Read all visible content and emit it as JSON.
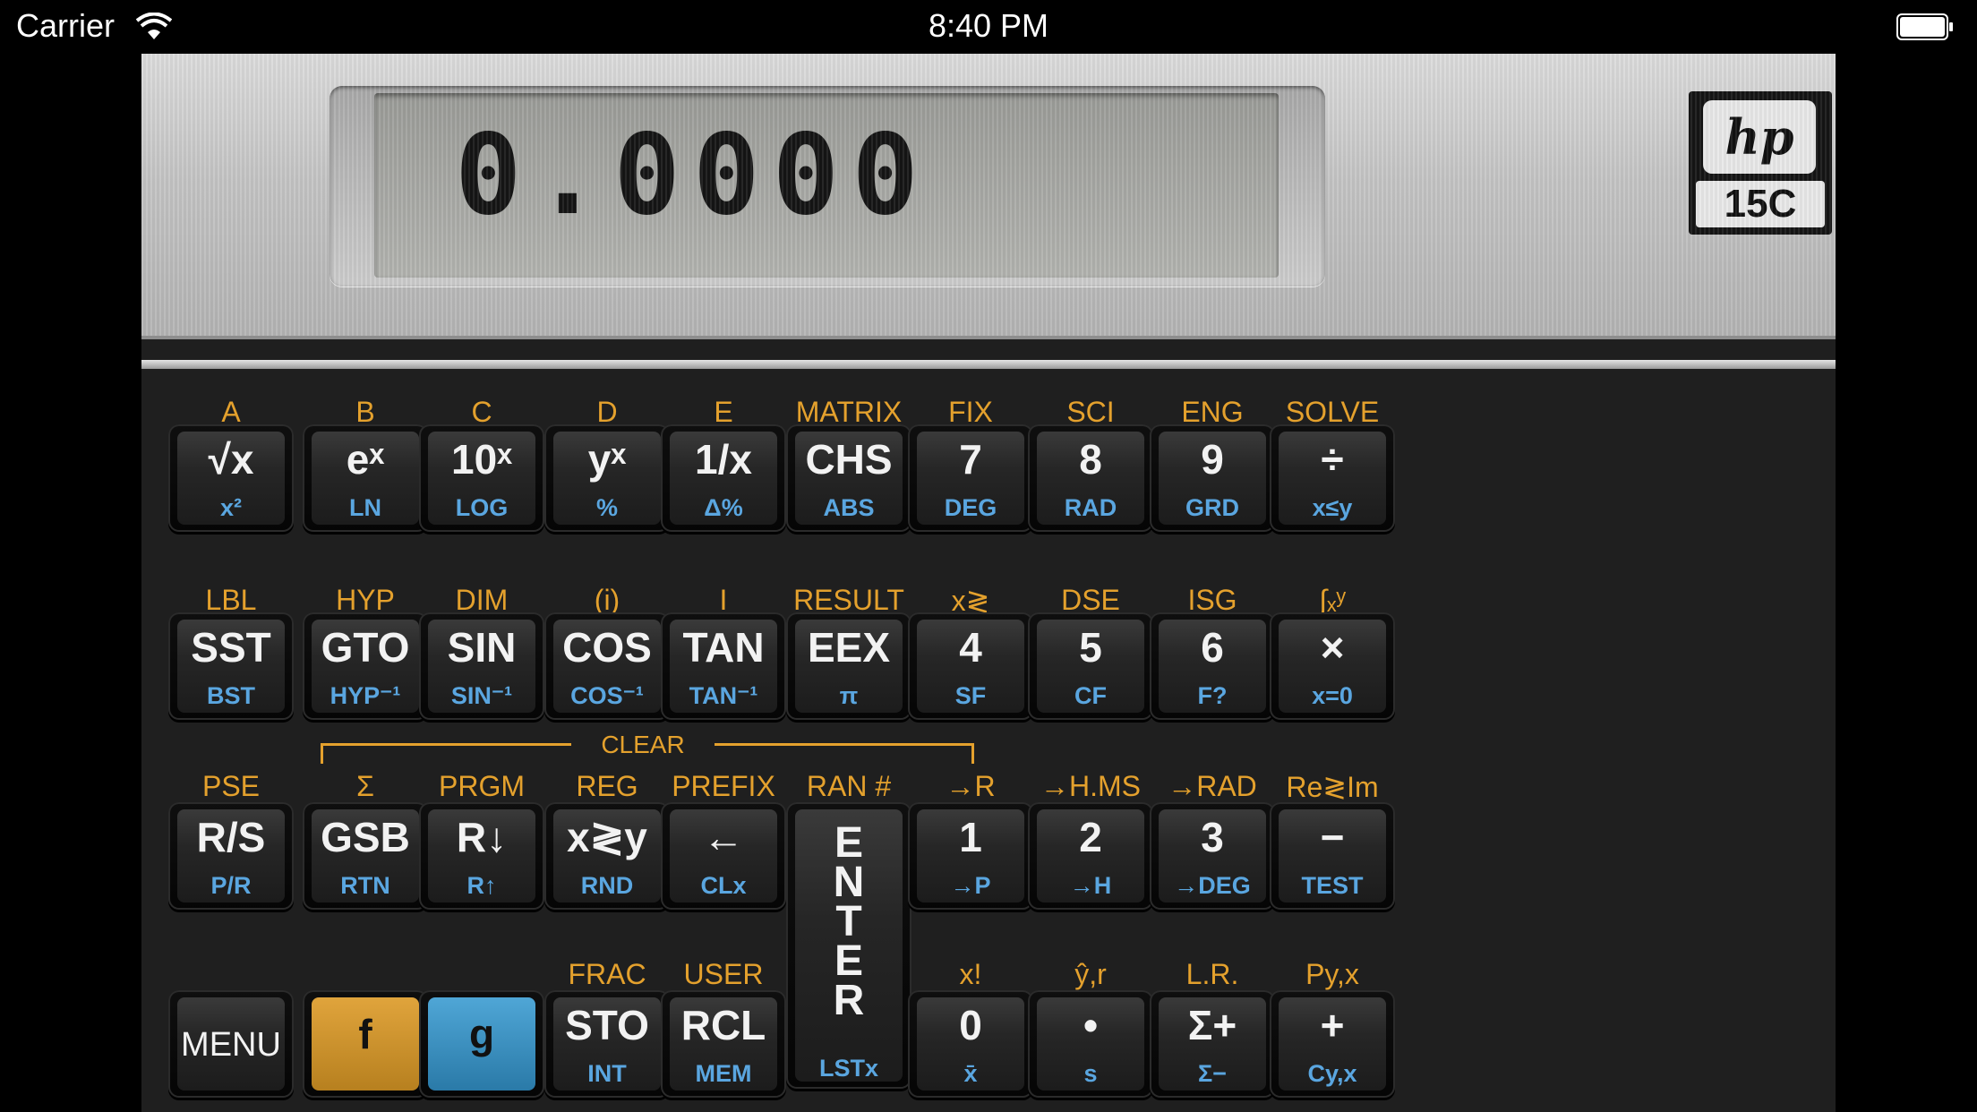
{
  "status_bar": {
    "carrier": "Carrier",
    "time": "8:40 PM"
  },
  "display": {
    "value": "0.0000"
  },
  "logo": {
    "brand": "hp",
    "model": "15C"
  },
  "clear_label": "CLEAR",
  "colors": {
    "f_label": "#e4a12d",
    "g_label": "#5aa6e0",
    "key_body": "#262626",
    "f_key": "#d49a2f",
    "g_key": "#3b92c4"
  },
  "rows": [
    {
      "keys": [
        {
          "f": "A",
          "main": "√x",
          "g": "x²"
        },
        {
          "f": "B",
          "main": "eˣ",
          "g": "LN"
        },
        {
          "f": "C",
          "main": "10ˣ",
          "g": "LOG"
        },
        {
          "f": "D",
          "main": "yˣ",
          "g": "%"
        },
        {
          "f": "E",
          "main": "1/x",
          "g": "Δ%"
        },
        {
          "f": "MATRIX",
          "main": "CHS",
          "g": "ABS"
        },
        {
          "f": "FIX",
          "main": "7",
          "g": "DEG"
        },
        {
          "f": "SCI",
          "main": "8",
          "g": "RAD"
        },
        {
          "f": "ENG",
          "main": "9",
          "g": "GRD"
        },
        {
          "f": "SOLVE",
          "main": "÷",
          "g": "x≤y"
        }
      ]
    },
    {
      "keys": [
        {
          "f": "LBL",
          "main": "SST",
          "g": "BST"
        },
        {
          "f": "HYP",
          "main": "GTO",
          "g": "HYP⁻¹"
        },
        {
          "f": "DIM",
          "main": "SIN",
          "g": "SIN⁻¹"
        },
        {
          "f": "(i)",
          "main": "COS",
          "g": "COS⁻¹"
        },
        {
          "f": "I",
          "main": "TAN",
          "g": "TAN⁻¹"
        },
        {
          "f": "RESULT",
          "main": "EEX",
          "g": "π"
        },
        {
          "f": "x≷",
          "main": "4",
          "g": "SF"
        },
        {
          "f": "DSE",
          "main": "5",
          "g": "CF"
        },
        {
          "f": "ISG",
          "main": "6",
          "g": "F?"
        },
        {
          "f": "∫ₓʸ",
          "main": "×",
          "g": "x=0"
        }
      ]
    },
    {
      "keys": [
        {
          "f": "PSE",
          "main": "R/S",
          "g": "P/R"
        },
        {
          "f": "Σ",
          "main": "GSB",
          "g": "RTN"
        },
        {
          "f": "PRGM",
          "main": "R↓",
          "g": "R↑"
        },
        {
          "f": "REG",
          "main": "x≷y",
          "g": "RND"
        },
        {
          "f": "PREFIX",
          "main": "←",
          "g": "CLx"
        },
        {
          "f": "RAN #",
          "main": "ENTER",
          "g": "LSTx"
        },
        {
          "f": "→R",
          "main": "1",
          "g": "→P"
        },
        {
          "f": "→H.MS",
          "main": "2",
          "g": "→H"
        },
        {
          "f": "→RAD",
          "main": "3",
          "g": "→DEG"
        },
        {
          "f": "Re≷Im",
          "main": "−",
          "g": "TEST"
        }
      ]
    },
    {
      "keys": [
        {
          "f": "",
          "main": "MENU",
          "g": ""
        },
        {
          "f": "",
          "main": "f",
          "g": ""
        },
        {
          "f": "",
          "main": "g",
          "g": ""
        },
        {
          "f": "FRAC",
          "main": "STO",
          "g": "INT"
        },
        {
          "f": "USER",
          "main": "RCL",
          "g": "MEM"
        },
        {
          "f": "x!",
          "main": "0",
          "g": "x̄"
        },
        {
          "f": "ŷ,r",
          "main": "•",
          "g": "s"
        },
        {
          "f": "L.R.",
          "main": "Σ+",
          "g": "Σ−"
        },
        {
          "f": "Py,x",
          "main": "+",
          "g": "Cy,x"
        }
      ]
    }
  ]
}
